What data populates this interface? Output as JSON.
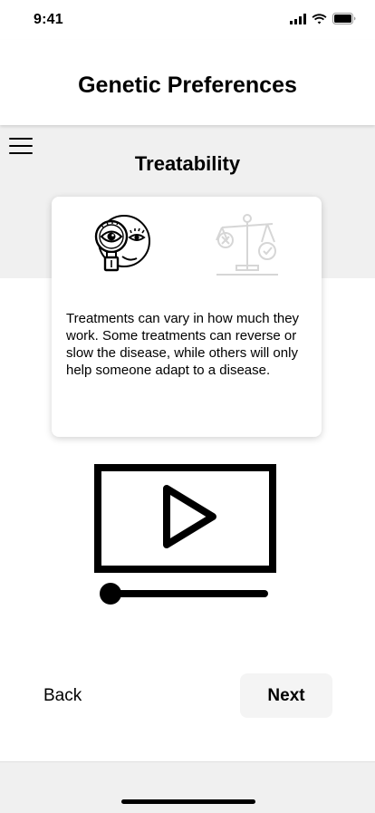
{
  "status_bar": {
    "time": "9:41",
    "icons": [
      "cellular-signal-icon",
      "wifi-icon",
      "battery-icon"
    ]
  },
  "header": {
    "title": "Genetic Preferences"
  },
  "menu": {
    "icon": "hamburger-menu-icon"
  },
  "section": {
    "title": "Treatability"
  },
  "card": {
    "icons": [
      "magnifier-eye-face-icon",
      "scale-balance-icon"
    ],
    "description": "Treatments can vary in how much they work. Some treatments can reverse or slow the disease, while others will only help someone adapt to a disease."
  },
  "video": {
    "icon": "play-icon",
    "progress": 0
  },
  "navigation": {
    "back_label": "Back",
    "next_label": "Next"
  },
  "colors": {
    "background": "#ffffff",
    "band": "#f0f0f0",
    "next_button_bg": "#f4f4f4",
    "inactive_icon": "#d6d6d6"
  }
}
